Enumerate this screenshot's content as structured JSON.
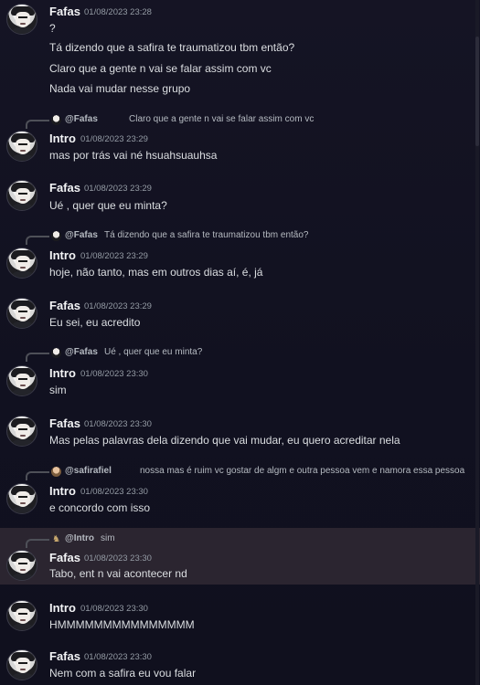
{
  "messages": [
    {
      "name": "Fafas",
      "timestamp": "01/08/2023 23:28",
      "lines": [
        "?",
        "Tá dizendo que a safira te traumatizou tbm então?",
        "Claro que a gente n vai se falar assim com vc",
        "Nada vai mudar nesse grupo"
      ]
    },
    {
      "reply": {
        "name": "@Fafas",
        "text": "Claro que a gente n vai se falar assim com vc"
      },
      "name": "Intro",
      "timestamp": "01/08/2023 23:29",
      "lines": [
        "mas por trás vai né hsuahsuauhsa"
      ]
    },
    {
      "name": "Fafas",
      "timestamp": "01/08/2023 23:29",
      "lines": [
        "Ué , quer que eu minta?"
      ]
    },
    {
      "reply": {
        "name": "@Fafas",
        "text": "Tá dizendo que a safira te traumatizou tbm então?"
      },
      "name": "Intro",
      "timestamp": "01/08/2023 23:29",
      "lines": [
        "hoje, não tanto, mas em outros dias aí, é, já"
      ]
    },
    {
      "name": "Fafas",
      "timestamp": "01/08/2023 23:29",
      "lines": [
        "Eu sei, eu acredito"
      ]
    },
    {
      "reply": {
        "name": "@Fafas",
        "text": "Ué , quer que eu minta?"
      },
      "name": "Intro",
      "timestamp": "01/08/2023 23:30",
      "lines": [
        "sim"
      ]
    },
    {
      "name": "Fafas",
      "timestamp": "01/08/2023 23:30",
      "lines": [
        "Mas pelas palavras dela dizendo que vai mudar, eu quero acreditar nela"
      ]
    },
    {
      "reply": {
        "name": "@safirafiel",
        "text": "nossa mas é ruim vc gostar de algm e outra pessoa vem e namora essa pessoa"
      },
      "name": "Intro",
      "timestamp": "01/08/2023 23:30",
      "lines": [
        "e concordo com isso"
      ]
    },
    {
      "reply": {
        "name": "@Intro",
        "text": "sim"
      },
      "name": "Fafas",
      "timestamp": "01/08/2023 23:30",
      "lines": [
        "Tabo, ent n vai acontecer nd"
      ]
    },
    {
      "name": "Intro",
      "timestamp": "01/08/2023 23:30",
      "lines": [
        "HMMMMMMMMMMMMMMM"
      ]
    },
    {
      "name": "Fafas",
      "timestamp": "01/08/2023 23:30",
      "lines": [
        "Nem com a safira eu vou falar"
      ]
    }
  ]
}
